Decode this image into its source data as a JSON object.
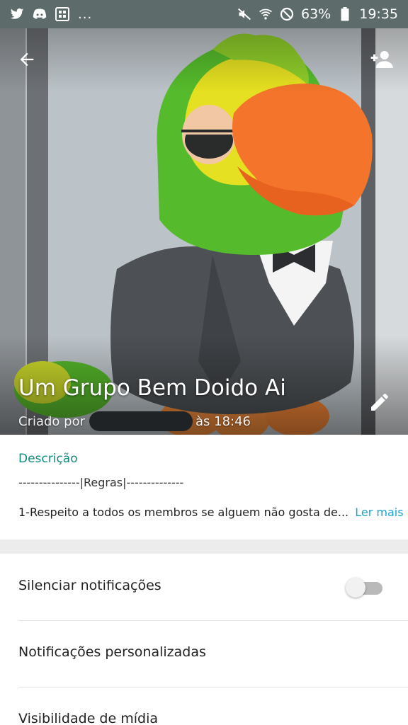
{
  "status_bar": {
    "left_icons": [
      "twitter-icon",
      "discord-icon",
      "app-grid-icon"
    ],
    "overflow": "...",
    "battery": "63%",
    "time": "19:35"
  },
  "header": {
    "group_name": "Um Grupo Bem Doido Ai",
    "created_prefix": "Criado por",
    "created_time": "às 18:46"
  },
  "description": {
    "label": "Descrição",
    "rules_line": "---------------|Regras|--------------",
    "text": "1-Respeito a todos os membros se alguem não gosta de...",
    "read_more": "Ler mais"
  },
  "settings": {
    "mute_label": "Silenciar notificações",
    "mute_enabled": false,
    "custom_notifications_label": "Notificações personalizadas",
    "media_visibility_label": "Visibilidade de mídia"
  },
  "colors": {
    "accent": "#0f8c7e",
    "link": "#1ea3c9",
    "status_bar": "#5d6b6b"
  }
}
